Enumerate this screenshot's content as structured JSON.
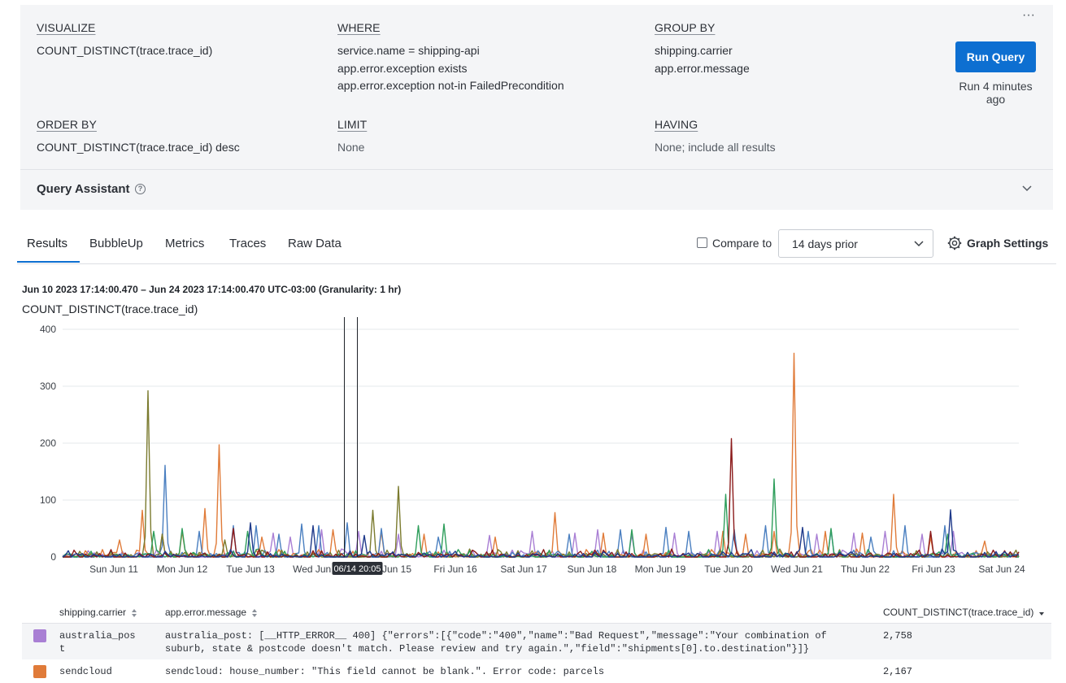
{
  "query": {
    "visualize": {
      "heading": "VISUALIZE",
      "lines": [
        "COUNT_DISTINCT(trace.trace_id)"
      ]
    },
    "where": {
      "heading": "WHERE",
      "lines": [
        "service.name = shipping-api",
        "app.error.exception exists",
        "app.error.exception not-in FailedPrecondition"
      ]
    },
    "group_by": {
      "heading": "GROUP BY",
      "lines": [
        "shipping.carrier",
        "app.error.message"
      ]
    },
    "order_by": {
      "heading": "ORDER BY",
      "lines": [
        "COUNT_DISTINCT(trace.trace_id) desc"
      ]
    },
    "limit": {
      "heading": "LIMIT",
      "lines": [
        "None"
      ]
    },
    "having": {
      "heading": "HAVING",
      "lines": [
        "None; include all results"
      ]
    },
    "more_label": "···",
    "run_button": "Run Query",
    "run_ago": "Run 4 minutes ago"
  },
  "query_assistant": {
    "title": "Query Assistant",
    "help_glyph": "?"
  },
  "tabs": [
    "Results",
    "BubbleUp",
    "Metrics",
    "Traces",
    "Raw Data"
  ],
  "active_tab": "Results",
  "compare": {
    "label": "Compare to",
    "checked": false,
    "selected": "14 days prior"
  },
  "graph_settings_label": "Graph Settings",
  "chart_header": {
    "range": "Jun 10 2023 17:14:00.470 – Jun 24 2023 17:14:00.470 UTC-03:00 (Granularity: 1 hr)",
    "metric": "COUNT_DISTINCT(trace.trace_id)",
    "marker_label": "06/14 20:05"
  },
  "chart_data": {
    "type": "line",
    "ylim": [
      0,
      400
    ],
    "yticks": [
      0,
      100,
      200,
      300,
      400
    ],
    "xticks": [
      "Sun Jun 11",
      "Mon Jun 12",
      "Tue Jun 13",
      "Wed Jun 14",
      "Thu Jun 15",
      "Fri Jun 16",
      "Sat Jun 17",
      "Sun Jun 18",
      "Mon Jun 19",
      "Tue Jun 20",
      "Wed Jun 21",
      "Thu Jun 22",
      "Fri Jun 23",
      "Sat Jun 24"
    ],
    "xlim_hours": [
      0,
      336
    ],
    "grid": true,
    "series": [
      {
        "color": "#a97fd4",
        "peaks": [
          [
            74,
            42
          ],
          [
            80,
            35
          ],
          [
            91,
            48
          ],
          [
            104,
            45
          ],
          [
            118,
            40
          ],
          [
            150,
            38
          ],
          [
            165,
            45
          ],
          [
            180,
            42
          ],
          [
            188,
            48
          ],
          [
            200,
            40
          ],
          [
            215,
            42
          ],
          [
            230,
            45
          ],
          [
            265,
            40
          ],
          [
            278,
            42
          ],
          [
            289,
            45
          ],
          [
            302,
            40
          ],
          [
            313,
            45
          ]
        ]
      },
      {
        "color": "#e07b39",
        "peaks": [
          [
            20,
            30
          ],
          [
            28,
            82
          ],
          [
            35,
            40
          ],
          [
            42,
            45
          ],
          [
            50,
            85
          ],
          [
            55,
            197
          ],
          [
            70,
            35
          ],
          [
            95,
            48
          ],
          [
            112,
            45
          ],
          [
            127,
            40
          ],
          [
            152,
            35
          ],
          [
            173,
            78
          ],
          [
            190,
            42
          ],
          [
            205,
            40
          ],
          [
            232,
            45
          ],
          [
            240,
            40
          ],
          [
            250,
            45
          ],
          [
            257,
            358
          ],
          [
            268,
            45
          ],
          [
            281,
            42
          ],
          [
            292,
            110
          ],
          [
            305,
            35
          ],
          [
            324,
            28
          ]
        ]
      },
      {
        "color": "#4a7fc0",
        "peaks": [
          [
            36,
            161
          ],
          [
            48,
            45
          ],
          [
            60,
            55
          ],
          [
            68,
            55
          ],
          [
            76,
            40
          ],
          [
            84,
            58
          ],
          [
            90,
            55
          ],
          [
            100,
            60
          ],
          [
            112,
            50
          ],
          [
            132,
            35
          ],
          [
            178,
            40
          ],
          [
            196,
            48
          ],
          [
            212,
            52
          ],
          [
            220,
            45
          ],
          [
            236,
            48
          ],
          [
            247,
            55
          ],
          [
            262,
            45
          ],
          [
            270,
            48
          ],
          [
            284,
            35
          ],
          [
            296,
            55
          ],
          [
            310,
            55
          ]
        ]
      },
      {
        "color": "#7b7b2f",
        "peaks": [
          [
            30,
            292
          ],
          [
            35,
            40
          ],
          [
            57,
            30
          ],
          [
            109,
            82
          ],
          [
            118,
            124
          ]
        ]
      },
      {
        "color": "#2e9e5b",
        "peaks": [
          [
            32,
            45
          ],
          [
            42,
            50
          ],
          [
            65,
            45
          ],
          [
            125,
            55
          ],
          [
            134,
            58
          ],
          [
            200,
            48
          ],
          [
            233,
            110
          ],
          [
            250,
            137
          ],
          [
            270,
            50
          ],
          [
            311,
            40
          ]
        ]
      },
      {
        "color": "#8b1a1a",
        "peaks": [
          [
            60,
            50
          ],
          [
            235,
            208
          ],
          [
            305,
            45
          ],
          [
            327,
            12
          ]
        ]
      },
      {
        "color": "#1f3a8a",
        "peaks": [
          [
            66,
            60
          ],
          [
            88,
            55
          ],
          [
            106,
            38
          ],
          [
            260,
            52
          ],
          [
            312,
            83
          ]
        ]
      }
    ],
    "marker_hour": 99
  },
  "table": {
    "columns": [
      "shipping.carrier",
      "app.error.message",
      "COUNT_DISTINCT(trace.trace_id)"
    ],
    "rows": [
      {
        "carrier": "australia_post",
        "message": "australia_post: [__HTTP_ERROR__ 400] {\"errors\":[{\"code\":\"400\",\"name\":\"Bad Request\",\"message\":\"Your combination of suburb, state & postcode doesn't match. Please review and try again.\",\"field\":\"shipments[0].to.destination\"}]}",
        "count": "2,758",
        "color": "#a97fd4"
      },
      {
        "carrier": "sendcloud",
        "message": "sendcloud: house_number: \"This field cannot be blank.\". Error code: parcels",
        "count": "2,167",
        "color": "#e07b39"
      }
    ]
  }
}
